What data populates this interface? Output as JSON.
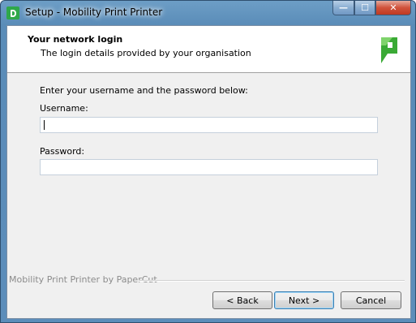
{
  "window": {
    "title": "Setup - Mobility Print Printer",
    "minimize_glyph": "—",
    "maximize_glyph": "☐",
    "close_glyph": "✕"
  },
  "header": {
    "title": "Your network login",
    "subtitle": "The login details provided by your organisation",
    "logo_icon": "papercut-logo-icon",
    "brand_color": "#3aaa35"
  },
  "form": {
    "instructions": "Enter your username and the password below:",
    "username_label": "Username:",
    "username_value": "",
    "password_label": "Password:",
    "password_value": ""
  },
  "footer": {
    "brand_text": "Mobility Print Printer by PaperCut"
  },
  "buttons": {
    "back": "< Back",
    "next": "Next >",
    "cancel": "Cancel"
  }
}
